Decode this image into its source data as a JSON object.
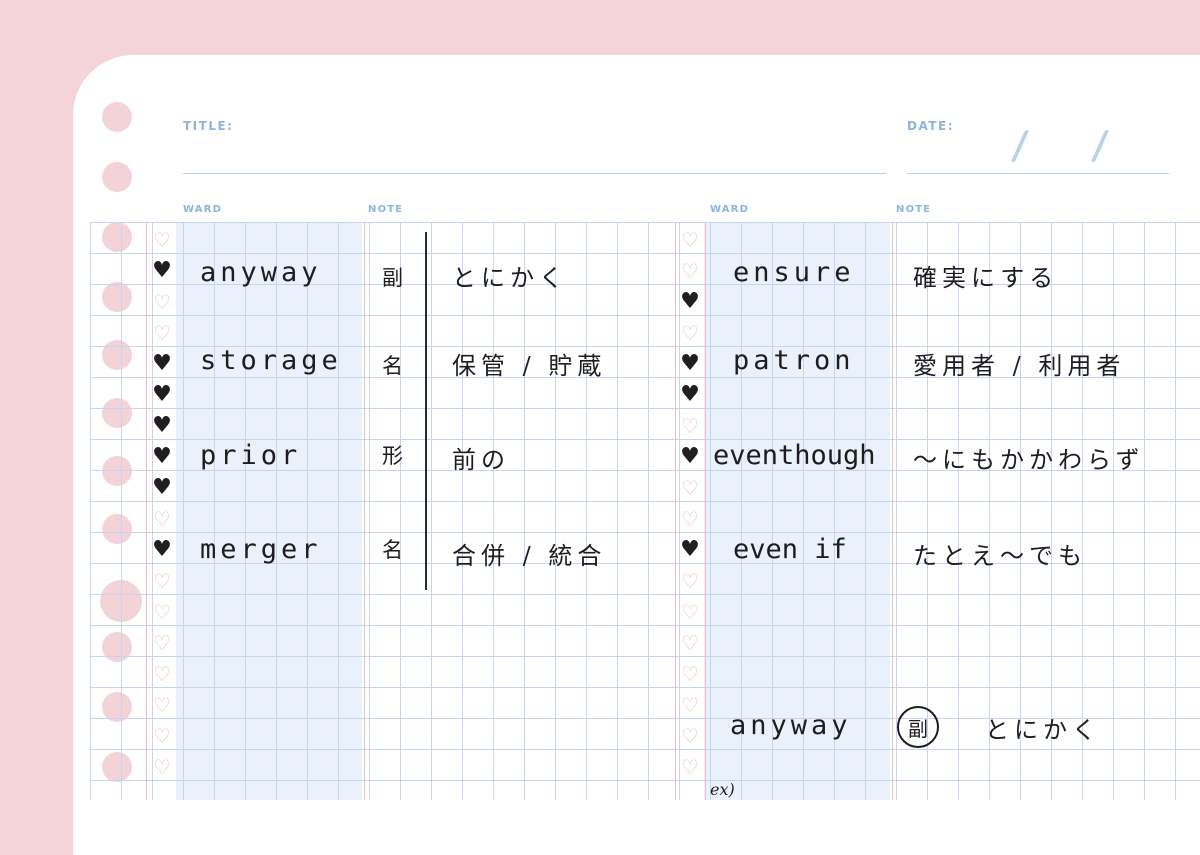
{
  "header": {
    "title_label": "TITLE:",
    "date_label": "DATE:"
  },
  "columns": {
    "left_word_label": "WARD",
    "left_note_label": "NOTE",
    "right_word_label": "WARD",
    "right_note_label": "NOTE"
  },
  "left_entries": [
    {
      "word": "anyway",
      "pos": "副",
      "meaning": "とにかく"
    },
    {
      "word": "storage",
      "pos": "名",
      "meaning": "保管 / 貯蔵"
    },
    {
      "word": "prior",
      "pos": "形",
      "meaning": "前の"
    },
    {
      "word": "merger",
      "pos": "名",
      "meaning": "合併 / 統合"
    }
  ],
  "right_entries": [
    {
      "word": "ensure",
      "meaning": "確実にする"
    },
    {
      "word": "patron",
      "meaning": "愛用者 / 利用者"
    },
    {
      "word": "eventhough",
      "meaning": "〜にもかかわらず"
    },
    {
      "word": "even if",
      "meaning": "たとえ〜でも"
    }
  ],
  "example": {
    "word": "anyway",
    "pos": "副",
    "meaning": "とにかく",
    "ex_label": "ex)"
  },
  "icons": {
    "filled_heart": "heart-filled-icon",
    "empty_heart": "heart-outline-icon"
  },
  "colors": {
    "background": "#f4d4d9",
    "grid_line": "#c5d6ec",
    "label_blue": "#8eb4de",
    "ink": "#1d1d1f",
    "heart_outline": "#f2b9c4"
  }
}
